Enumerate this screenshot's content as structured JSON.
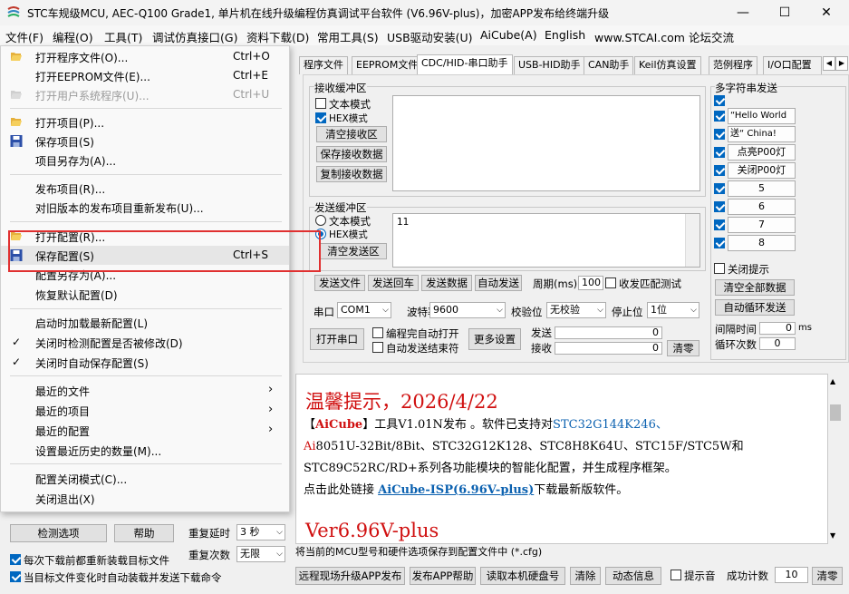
{
  "window": {
    "title": "STC车规级MCU, AEC-Q100 Grade1, 单片机在线升级编程仿真调试平台软件 (V6.96V-plus)，加密APP发布给终端升级",
    "minimize": "—",
    "maximize": "☐",
    "close": "✕"
  },
  "menubar": [
    "文件(F)",
    "编程(O)",
    "工具(T)",
    "调试仿真接口(G)",
    "资料下载(D)",
    "常用工具(S)",
    "USB驱动安装(U)",
    "AiCube(A)",
    "English",
    "www.STCAI.com 论坛交流"
  ],
  "file_menu": {
    "items": [
      {
        "label": "打开程序文件(O)...",
        "shortcut": "Ctrl+O"
      },
      {
        "label": "打开EEPROM文件(E)...",
        "shortcut": "Ctrl+E"
      },
      {
        "label": "打开用户系统程序(U)...",
        "shortcut": "Ctrl+U"
      },
      {
        "label": "打开项目(P)...",
        "shortcut": ""
      },
      {
        "label": "保存项目(S)",
        "shortcut": ""
      },
      {
        "label": "项目另存为(A)...",
        "shortcut": ""
      },
      {
        "label": "发布项目(R)...",
        "shortcut": ""
      },
      {
        "label": "对旧版本的发布项目重新发布(U)...",
        "shortcut": ""
      },
      {
        "label": "打开配置(R)...",
        "shortcut": ""
      },
      {
        "label": "保存配置(S)",
        "shortcut": "Ctrl+S"
      },
      {
        "label": "配置另存为(A)...",
        "shortcut": ""
      },
      {
        "label": "恢复默认配置(D)",
        "shortcut": ""
      },
      {
        "label": "启动时加载最新配置(L)",
        "shortcut": ""
      },
      {
        "label": "关闭时检测配置是否被修改(D)",
        "shortcut": ""
      },
      {
        "label": "关闭时自动保存配置(S)",
        "shortcut": ""
      },
      {
        "label": "最近的文件",
        "shortcut": ""
      },
      {
        "label": "最近的项目",
        "shortcut": ""
      },
      {
        "label": "最近的配置",
        "shortcut": ""
      },
      {
        "label": "设置最近历史的数量(M)...",
        "shortcut": ""
      },
      {
        "label": "配置关闭模式(C)...",
        "shortcut": ""
      },
      {
        "label": "关闭退出(X)",
        "shortcut": ""
      }
    ],
    "check": "✓",
    "submenu_arrow": "›"
  },
  "tabs": [
    "程序文件",
    "EEPROM文件",
    "CDC/HID-串口助手",
    "USB-HID助手",
    "CAN助手",
    "Keil仿真设置",
    "范例程序",
    "I/O口配置"
  ],
  "tab_nav": {
    "left": "◀",
    "right": "▶"
  },
  "receive": {
    "group": "接收缓冲区",
    "text_mode": "文本模式",
    "hex_mode": "HEX模式",
    "clear": "清空接收区",
    "save": "保存接收数据",
    "copy": "复制接收数据"
  },
  "send": {
    "group": "发送缓冲区",
    "text_mode": "文本模式",
    "hex_mode": "HEX模式",
    "clear": "清空发送区",
    "content": "11",
    "send_file": "发送文件",
    "send_return": "发送回车",
    "send_data": "发送数据",
    "auto_send": "自动发送",
    "period_label": "周期(ms)",
    "period_value": "100",
    "match_label": "收发匹配测试"
  },
  "serial": {
    "port_label": "串口",
    "port_value": "COM1",
    "baud_label": "波特率",
    "baud_value": "9600",
    "parity_label": "校验位",
    "parity_value": "无校验",
    "stop_label": "停止位",
    "stop_value": "1位",
    "open": "打开串口",
    "auto_open": "编程完自动打开",
    "auto_send_end": "自动发送结束符",
    "more": "更多设置",
    "sent_label": "发送",
    "sent_value": "0",
    "recv_label": "接收",
    "recv_value": "0",
    "clear_counts": "清零"
  },
  "multi": {
    "group": "多字符串发送",
    "rows": [
      "“Hello World",
      "送“ China!",
      "点亮P00灯",
      "关闭P00灯",
      "5",
      "6",
      "7",
      "8"
    ],
    "close_tip": "关闭提示",
    "clear_all": "清空全部数据",
    "auto_loop": "自动循环发送",
    "interval_label": "间隔时间",
    "interval_value": "0",
    "interval_unit": "ms",
    "loop_label": "循环次数",
    "loop_value": "0"
  },
  "info": {
    "heading": "温馨提示，2026/4/22",
    "l1a": "【",
    "l1b": "AiCube",
    "l1c": "】工具V1.01N发布 。软件已支持对",
    "l1d": "STC32G144K246、",
    "l2a": "Ai",
    "l2b": "8051U-32Bit/8Bit、STC32G12K128、STC8H8K64U、STC15F/STC5W和",
    "l3": "STC89C52RC/RD+系列各功能模块的智能化配置，并生成程序框架。",
    "l4a": "点击此处链接 ",
    "l4b": "AiCube-ISP(6.96V-plus)",
    "l4c": "下载最新版软件。",
    "l5": "Ver6.96V-plus"
  },
  "status_text": "将当前的MCU型号和硬件选项保存到配置文件中 (*.cfg)",
  "bottom": {
    "remote": "远程现场升级APP发布",
    "publish_help": "发布APP帮助",
    "read_disk": "读取本机硬盘号",
    "clear": "清除",
    "animation": "动态信息",
    "tone": "提示音",
    "success_label": "成功计数",
    "success_value": "10",
    "zero": "清零"
  },
  "left_bottom": {
    "check_options": "检测选项",
    "help": "帮助",
    "retry_delay_label": "重复延时",
    "retry_delay_value": "3 秒",
    "retry_count_label": "重复次数",
    "retry_count_value": "无限",
    "reload": "每次下载前都重新装载目标文件",
    "auto_load": "当目标文件变化时自动装载并发送下载命令"
  },
  "colors": {
    "accent": "#0067c0",
    "red": "#d01010",
    "highlight_box": "#e03030",
    "link": "#0b61b0"
  }
}
